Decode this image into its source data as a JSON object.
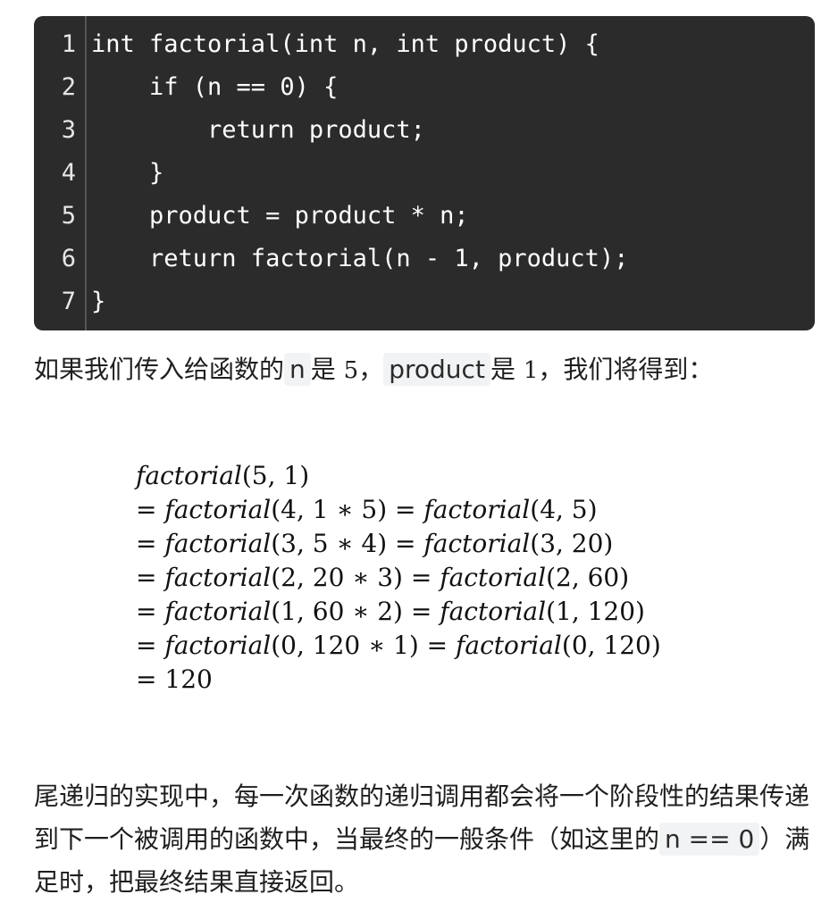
{
  "code": {
    "lines": [
      {
        "num": "1",
        "text": "int factorial(int n, int product) {"
      },
      {
        "num": "2",
        "text": "    if (n == 0) {"
      },
      {
        "num": "3",
        "text": "        return product;"
      },
      {
        "num": "4",
        "text": "    }"
      },
      {
        "num": "5",
        "text": "    product = product * n;"
      },
      {
        "num": "6",
        "text": "    return factorial(n - 1, product);"
      },
      {
        "num": "7",
        "text": "}"
      }
    ]
  },
  "paragraph1": {
    "t1": "如果我们传入给函数的",
    "code_n": "n",
    "t2": "是 ",
    "num5": "5",
    "t3": "，",
    "code_product": "product",
    "t4": "是 ",
    "num1": "1",
    "t5": "，我们将得到："
  },
  "math": {
    "lines": [
      {
        "pre": "",
        "fn1": "factorial",
        "args1": "(5, 1)",
        "mid": "",
        "fn2": "",
        "args2": ""
      },
      {
        "pre": "= ",
        "fn1": "factorial",
        "args1": "(4, 1 ∗ 5)",
        "mid": " = ",
        "fn2": "factorial",
        "args2": "(4, 5)"
      },
      {
        "pre": "= ",
        "fn1": "factorial",
        "args1": "(3, 5 ∗ 4)",
        "mid": " = ",
        "fn2": "factorial",
        "args2": "(3, 20)"
      },
      {
        "pre": "= ",
        "fn1": "factorial",
        "args1": "(2, 20 ∗ 3)",
        "mid": " = ",
        "fn2": "factorial",
        "args2": "(2, 60)"
      },
      {
        "pre": "= ",
        "fn1": "factorial",
        "args1": "(1, 60 ∗ 2)",
        "mid": " = ",
        "fn2": "factorial",
        "args2": "(1, 120)"
      },
      {
        "pre": "= ",
        "fn1": "factorial",
        "args1": "(0, 120 ∗ 1)",
        "mid": " = ",
        "fn2": "factorial",
        "args2": "(0, 120)"
      },
      {
        "pre": "= ",
        "fn1": "",
        "args1": "120",
        "mid": "",
        "fn2": "",
        "args2": ""
      }
    ]
  },
  "paragraph2": {
    "t1": "尾递归的实现中，每一次函数的递归调用都会将一个阶段性的结果传递到下一个被调用的函数中，当最终的一般条件（如这里的",
    "code": "n == 0",
    "t2": "）满足时，把最终结果直接返回。"
  }
}
